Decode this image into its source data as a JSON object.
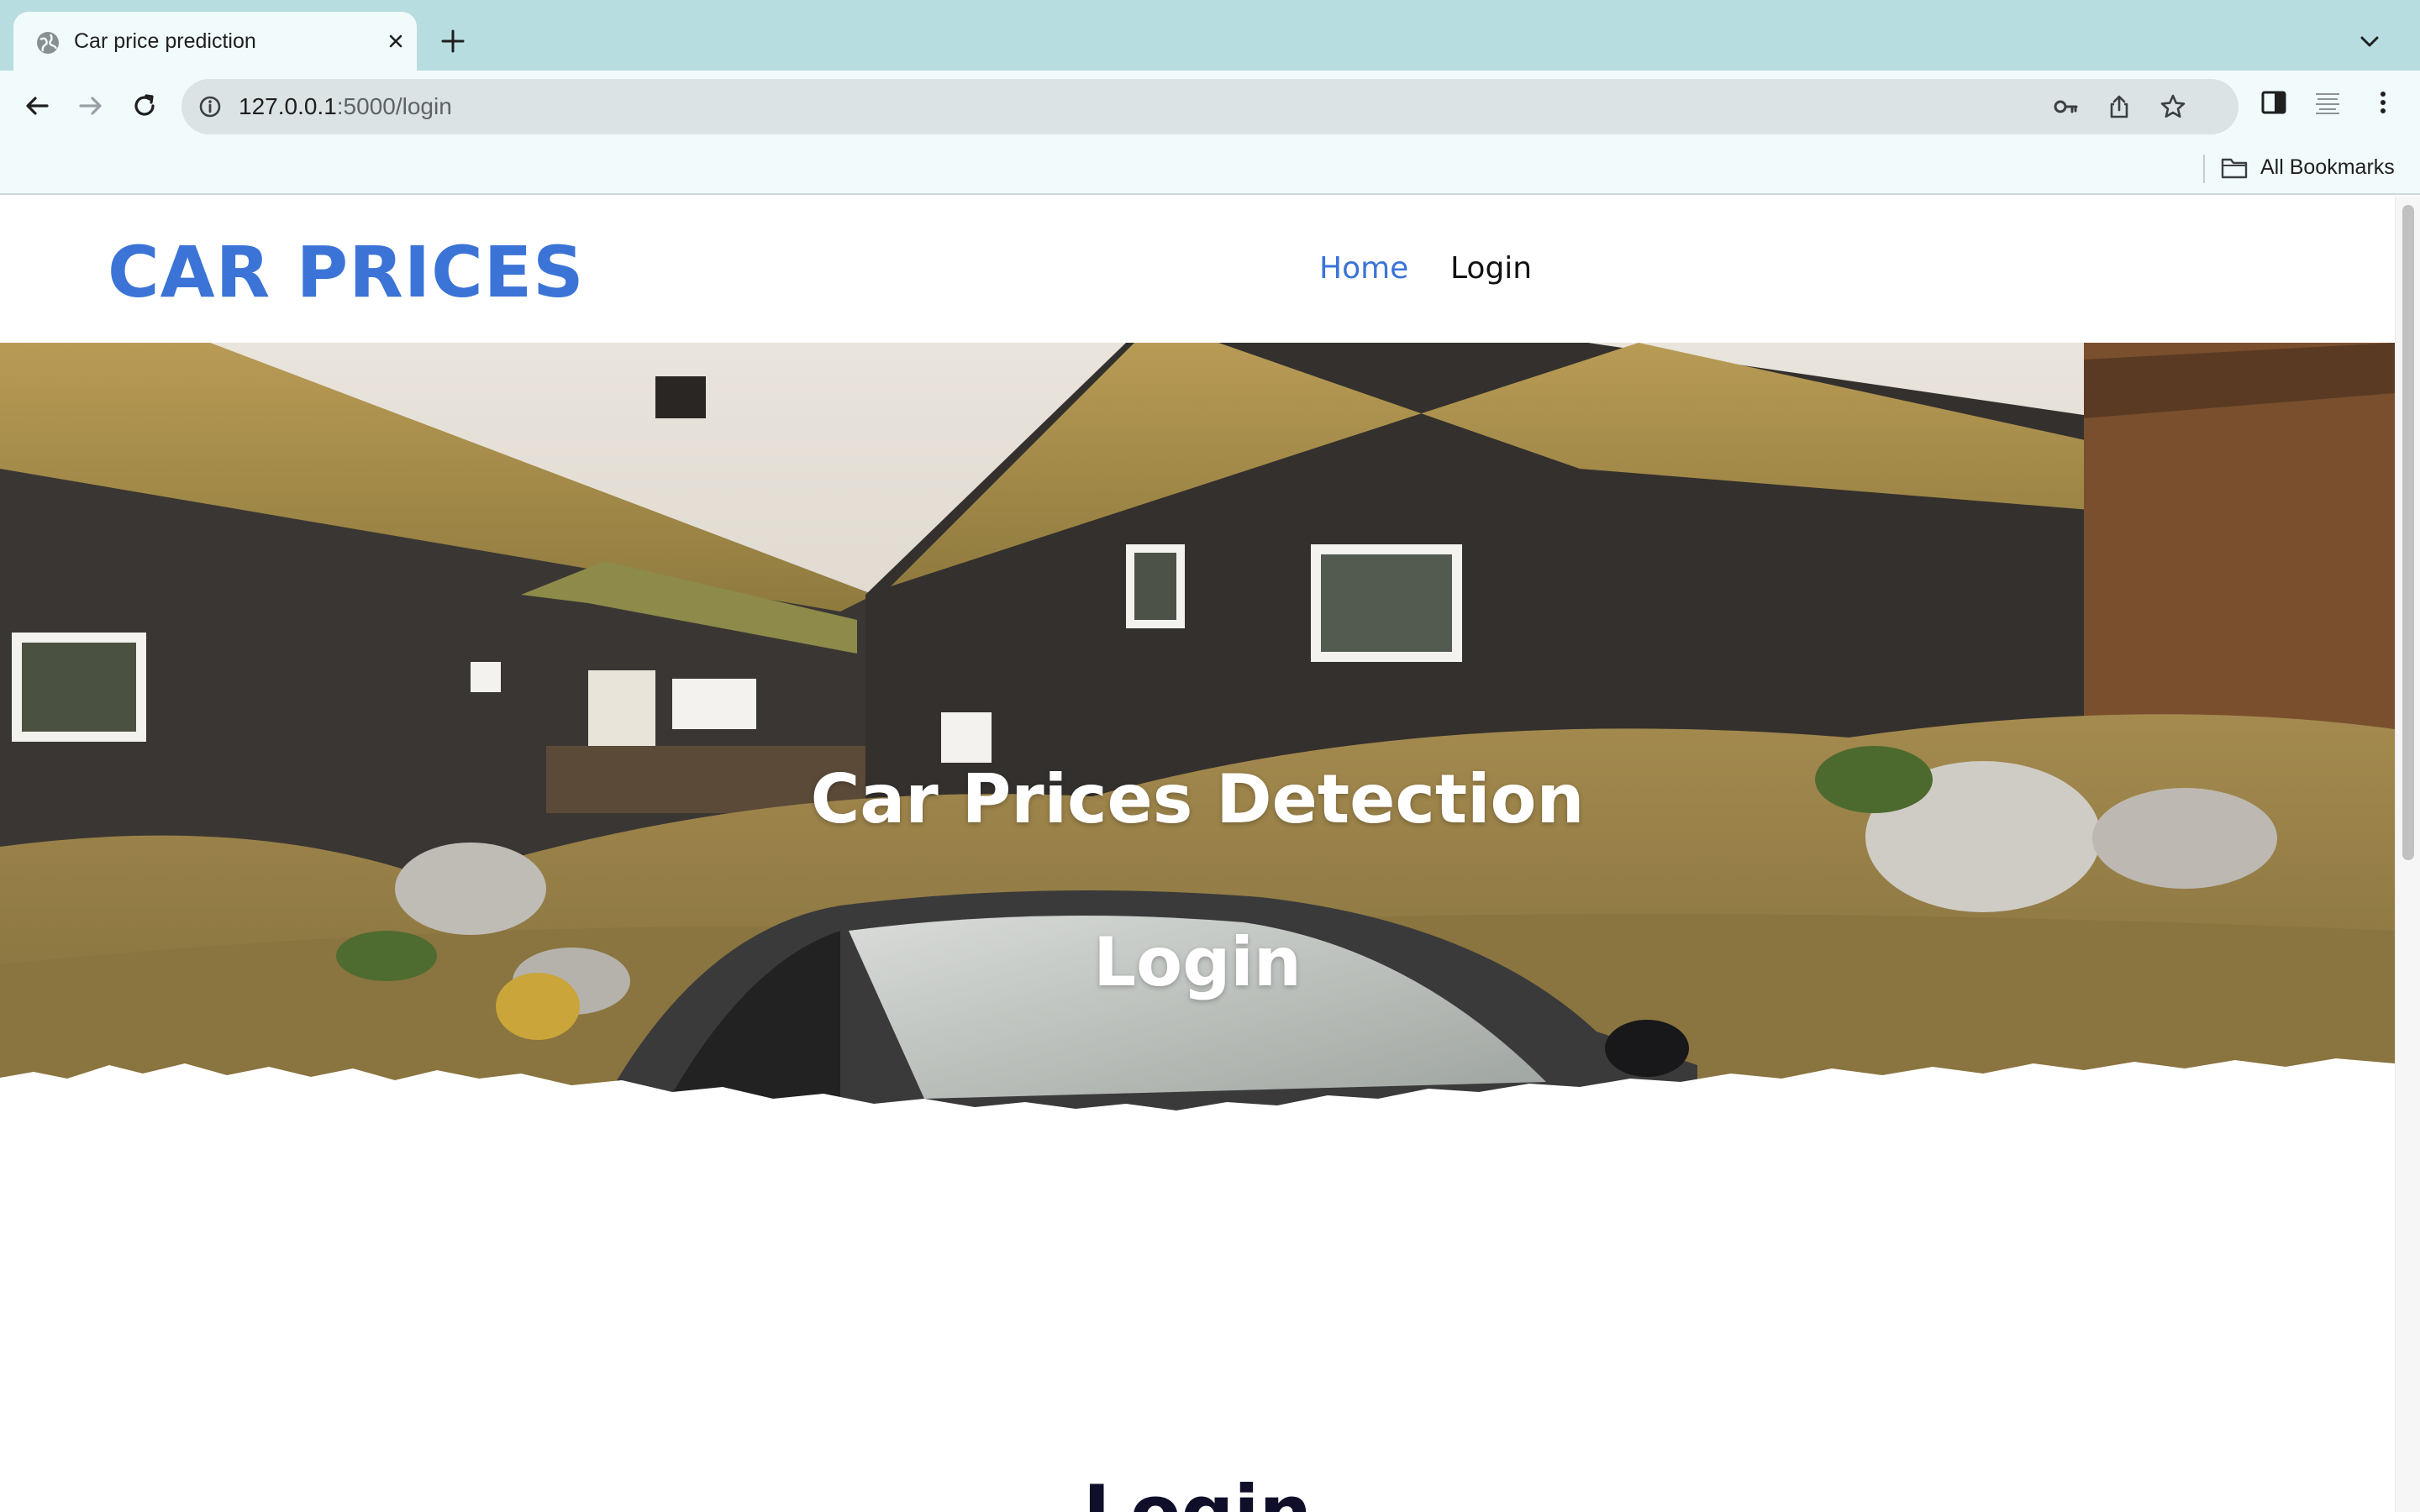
{
  "browser": {
    "tab_title": "Car price prediction",
    "url_host": "127.0.0.1",
    "url_rest": ":5000/login",
    "bookmarks_label": "All Bookmarks",
    "icons": {
      "tab_favicon": "globe-icon",
      "tab_close": "close-icon",
      "new_tab": "plus-icon",
      "tab_search": "chevron-down-icon",
      "back": "back-arrow-icon",
      "forward": "forward-arrow-icon",
      "reload": "reload-icon",
      "site_info": "info-icon",
      "passwords": "key-icon",
      "share": "share-icon",
      "bookmark": "star-icon",
      "side_panel": "side-panel-icon",
      "extension": "extension-icon",
      "menu": "kebab-menu-icon",
      "folder": "folder-icon"
    }
  },
  "site": {
    "brand": "CAR PRICES",
    "nav": [
      {
        "label": "Home",
        "active": true
      },
      {
        "label": "Login",
        "active": false
      }
    ],
    "hero": {
      "title": "Car Prices Detection",
      "subtitle": "Login"
    },
    "section_heading": "Login",
    "colors": {
      "brand": "#3b74d6",
      "nav_active": "#3b74d6",
      "nav_default": "#111111",
      "heading": "#0f0f2a",
      "tabstrip": "#b7dde0",
      "toolbar": "#f1fbfc"
    }
  }
}
